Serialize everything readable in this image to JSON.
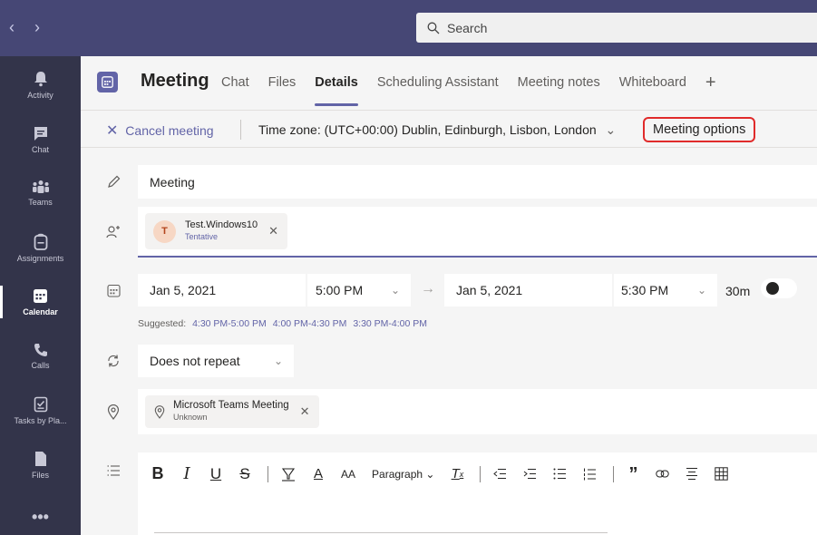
{
  "search": {
    "placeholder": "Search"
  },
  "rail": {
    "items": [
      {
        "label": "Activity"
      },
      {
        "label": "Chat"
      },
      {
        "label": "Teams"
      },
      {
        "label": "Assignments"
      },
      {
        "label": "Calendar"
      },
      {
        "label": "Calls"
      },
      {
        "label": "Tasks by Pla..."
      },
      {
        "label": "Files"
      }
    ]
  },
  "header": {
    "title": "Meeting",
    "tabs": [
      "Chat",
      "Files",
      "Details",
      "Scheduling Assistant",
      "Meeting notes",
      "Whiteboard"
    ],
    "active_tab": "Details"
  },
  "toolbar": {
    "cancel_label": "Cancel meeting",
    "timezone": "Time zone: (UTC+00:00) Dublin, Edinburgh, Lisbon, London",
    "meeting_options": "Meeting options"
  },
  "form": {
    "title_value": "Meeting",
    "attendee": {
      "initial": "T",
      "name": "Test.Windows10",
      "status": "Tentative"
    },
    "start_date": "Jan 5, 2021",
    "start_time": "5:00 PM",
    "end_date": "Jan 5, 2021",
    "end_time": "5:30 PM",
    "duration": "30m",
    "suggested_label": "Suggested:",
    "suggested_slots": [
      "4:30 PM-5:00 PM",
      "4:00 PM-4:30 PM",
      "3:30 PM-4:00 PM"
    ],
    "repeat": "Does not repeat",
    "location": {
      "name": "Microsoft Teams Meeting",
      "status": "Unknown"
    },
    "editor": {
      "paragraph_label": "Paragraph"
    }
  },
  "colors": {
    "accent": "#6264a7",
    "topbar": "#464775",
    "rail": "#33344a",
    "highlight_box": "#e02b2b"
  }
}
